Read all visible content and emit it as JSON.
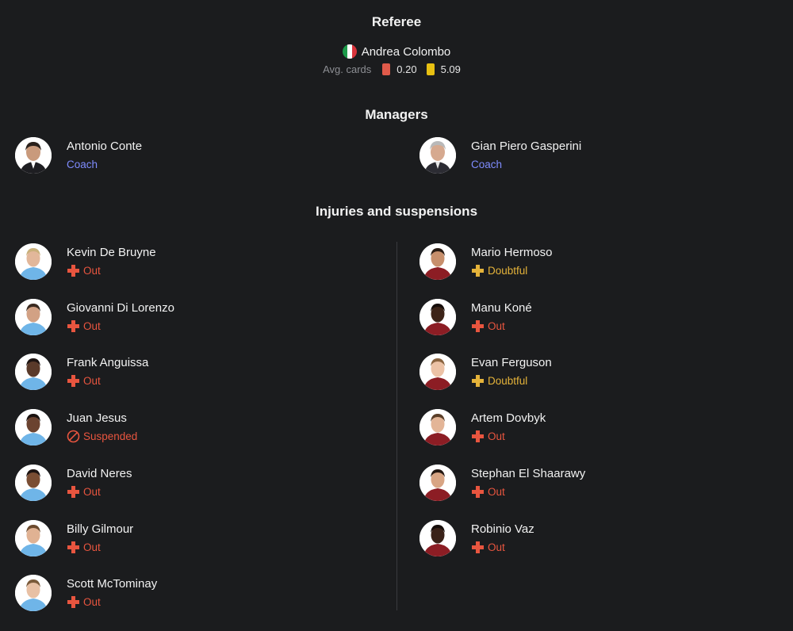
{
  "referee": {
    "title": "Referee",
    "name": "Andrea Colombo",
    "avg_cards_label": "Avg. cards",
    "red_avg": "0.20",
    "yellow_avg": "5.09"
  },
  "managers": {
    "title": "Managers",
    "home": {
      "name": "Antonio Conte",
      "role": "Coach"
    },
    "away": {
      "name": "Gian Piero Gasperini",
      "role": "Coach"
    }
  },
  "injuries": {
    "title": "Injuries and suspensions",
    "home": [
      {
        "name": "Kevin De Bruyne",
        "status": "Out",
        "type": "out"
      },
      {
        "name": "Giovanni Di Lorenzo",
        "status": "Out",
        "type": "out"
      },
      {
        "name": "Frank Anguissa",
        "status": "Out",
        "type": "out"
      },
      {
        "name": "Juan Jesus",
        "status": "Suspended",
        "type": "suspended"
      },
      {
        "name": "David Neres",
        "status": "Out",
        "type": "out"
      },
      {
        "name": "Billy Gilmour",
        "status": "Out",
        "type": "out"
      },
      {
        "name": "Scott McTominay",
        "status": "Out",
        "type": "out"
      }
    ],
    "away": [
      {
        "name": "Mario Hermoso",
        "status": "Doubtful",
        "type": "doubtful"
      },
      {
        "name": "Manu Koné",
        "status": "Out",
        "type": "out"
      },
      {
        "name": "Evan Ferguson",
        "status": "Doubtful",
        "type": "doubtful"
      },
      {
        "name": "Artem Dovbyk",
        "status": "Out",
        "type": "out"
      },
      {
        "name": "Stephan El Shaarawy",
        "status": "Out",
        "type": "out"
      },
      {
        "name": "Robinio Vaz",
        "status": "Out",
        "type": "out"
      }
    ]
  },
  "colors": {
    "background": "#1b1c1e",
    "out": "#e8553f",
    "doubtful": "#e5b33a",
    "coach": "#7f8cff",
    "red_card": "#e05a4a",
    "yellow_card": "#e8c012",
    "home_kit": "#6fb5e8",
    "away_kit": "#8c1d24"
  }
}
